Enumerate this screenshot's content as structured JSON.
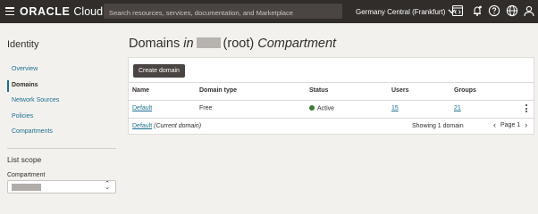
{
  "header": {
    "logo_brand": "ORACLE",
    "logo_product": "Cloud",
    "search_placeholder": "Search resources, services, documentation, and Marketplace",
    "region": "Germany Central (Frankfurt)",
    "icons": [
      "menu-icon",
      "code-editor-icon",
      "bell-icon",
      "help-icon",
      "globe-icon",
      "user-icon"
    ]
  },
  "sidebar": {
    "title": "Identity",
    "items": [
      {
        "label": "Overview",
        "active": false
      },
      {
        "label": "Domains",
        "active": true
      },
      {
        "label": "Network Sources",
        "active": false
      },
      {
        "label": "Policies",
        "active": false
      },
      {
        "label": "Compartments",
        "active": false
      }
    ],
    "scope_title": "List scope",
    "compartment_label": "Compartment"
  },
  "main": {
    "title_prefix": "Domains",
    "title_in": "in",
    "title_root": "(root)",
    "title_suffix": "Compartment",
    "create_button": "Create domain",
    "columns": [
      "Name",
      "Domain type",
      "Status",
      "Users",
      "Groups"
    ],
    "rows": [
      {
        "name": "Default",
        "domain_type": "Free",
        "status": "Active",
        "users": "15",
        "groups": "21"
      }
    ],
    "footer": {
      "default_link": "Default",
      "current_label": "(Current domain)",
      "showing": "Showing 1 domain",
      "page": "Page 1"
    }
  },
  "colors": {
    "topbar": "#312d2a",
    "background": "#f3f1ee",
    "link": "#1b6f8f",
    "status_active": "#3d7a33"
  }
}
